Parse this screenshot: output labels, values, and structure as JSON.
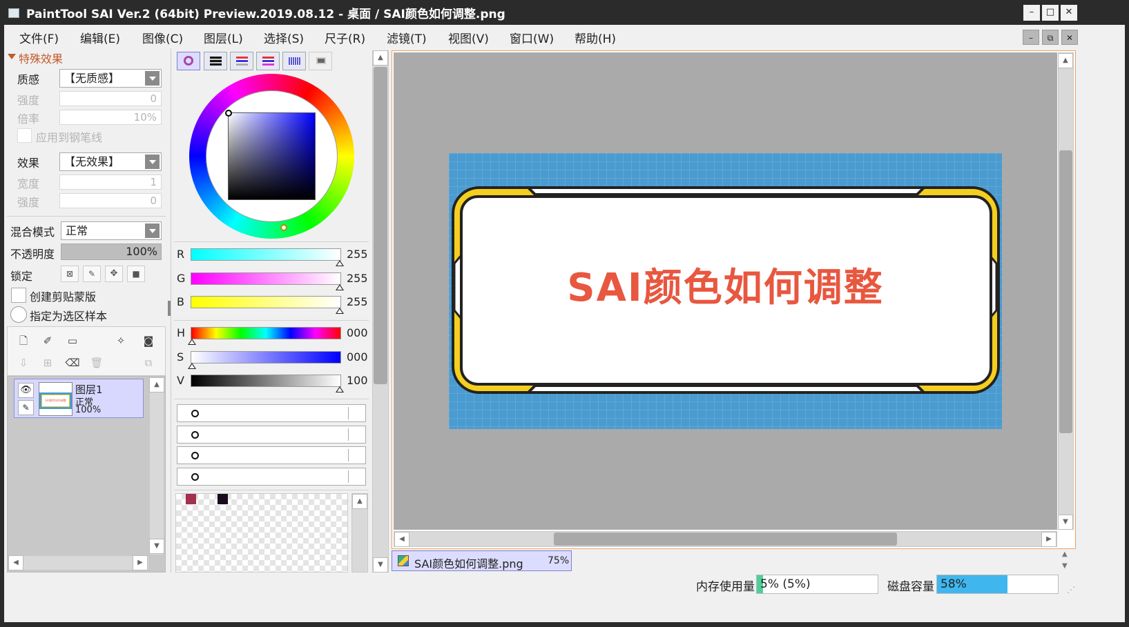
{
  "window": {
    "title": "PaintTool SAI Ver.2 (64bit) Preview.2019.08.12 - 桌面 / SAI颜色如何调整.png",
    "minimize_glyph": "–",
    "maximize_glyph": "□",
    "close_glyph": "✕"
  },
  "menu": [
    "文件(F)",
    "编辑(E)",
    "图像(C)",
    "图层(L)",
    "选择(S)",
    "尺子(R)",
    "滤镜(T)",
    "视图(V)",
    "窗口(W)",
    "帮助(H)"
  ],
  "effects_panel": {
    "section_title": "特殊效果",
    "texture_label": "质感",
    "texture_value": "【无质感】",
    "strength_label": "强度",
    "strength_value": "0",
    "scale_label": "倍率",
    "scale_value": "10%",
    "apply_to_pen_label": "应用到钢笔线",
    "effect_label": "效果",
    "effect_value": "【无效果】",
    "width_label": "宽度",
    "width_value": "1",
    "strength2_label": "强度",
    "strength2_value": "0"
  },
  "layer_props": {
    "blend_label": "混合模式",
    "blend_value": "正常",
    "opacity_label": "不透明度",
    "opacity_value": "100%",
    "opacity_fraction": 1.0,
    "lock_label": "锁定",
    "clip_label": "创建剪贴蒙版",
    "sample_label": "指定为选区样本"
  },
  "layers": [
    {
      "name": "图层1",
      "mode": "正常",
      "opacity": "100%",
      "thumb_text": "SAI颜色如何调整"
    }
  ],
  "color_panel": {
    "r_label": "R",
    "r_value": "255",
    "g_label": "G",
    "g_value": "255",
    "b_label": "B",
    "b_value": "255",
    "h_label": "H",
    "h_value": "000",
    "s_label": "S",
    "s_value": "000",
    "v_label": "V",
    "v_value": "100",
    "swatches": [
      "#a3304f",
      "#1a0b1e"
    ]
  },
  "canvas": {
    "banner_text": "SAI颜色如何调整",
    "banner_text_color": "#e8573f",
    "background_color": "#4a9bd0",
    "frame_accent": "#f5cf1f"
  },
  "document_tab": {
    "name": "SAI颜色如何调整.png",
    "zoom": "75%"
  },
  "status": {
    "memory_label": "内存使用量",
    "memory_value": "5% (5%)",
    "memory_fraction": 0.05,
    "disk_label": "磁盘容量",
    "disk_value": "58%",
    "disk_fraction": 0.58
  }
}
